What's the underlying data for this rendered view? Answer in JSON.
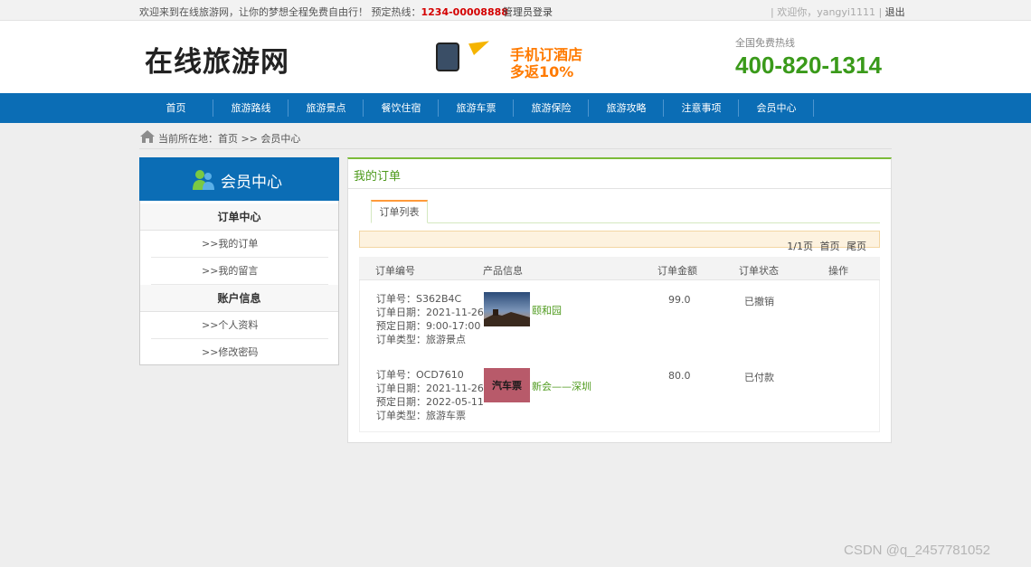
{
  "topbar": {
    "welcome": "欢迎来到在线旅游网，让你的梦想全程免费自由行！ 预定热线：",
    "hotline": "1234-00008888",
    "admin_login": "管理员登录",
    "user_greeting": "| 欢迎你，yangyi1111 |",
    "logout": "退出"
  },
  "header": {
    "logo": "在线旅游网",
    "promo_line1": "手机订酒店",
    "promo_line2": "多返10%",
    "hotline_label": "全国免费热线",
    "hotline_number": "400-820-1314"
  },
  "nav": {
    "items": [
      "首页",
      "旅游路线",
      "旅游景点",
      "餐饮住宿",
      "旅游车票",
      "旅游保险",
      "旅游攻略",
      "注意事项",
      "会员中心"
    ]
  },
  "breadcrumb": {
    "text": "当前所在地：首页 >> 会员中心"
  },
  "sidebar": {
    "title": "会员中心",
    "group1": "订单中心",
    "links1": [
      ">>我的订单",
      ">>我的留言"
    ],
    "group2": "账户信息",
    "links2": [
      ">>个人资料",
      ">>修改密码"
    ]
  },
  "main": {
    "title": "我的订单",
    "tab": "订单列表",
    "pager": "1/1页 首页 尾页",
    "columns": [
      "订单编号",
      "产品信息",
      "订单金额",
      "订单状态",
      "操作"
    ],
    "orders": [
      {
        "no": "订单号：S362B4C",
        "date": "订单日期：2021-11-26",
        "book": "预定日期：9:00-17:00",
        "type": "订单类型：旅游景点",
        "product": "颐和园",
        "amount": "99.0",
        "status": "已撤销"
      },
      {
        "no": "订单号：OCD7610",
        "date": "订单日期：2021-11-26",
        "book": "预定日期：2022-05-11",
        "type": "订单类型：旅游车票",
        "product": "新会——深圳",
        "thumb_text": "汽车票",
        "amount": "80.0",
        "status": "已付款"
      }
    ]
  },
  "watermark": "CSDN @q_2457781052"
}
